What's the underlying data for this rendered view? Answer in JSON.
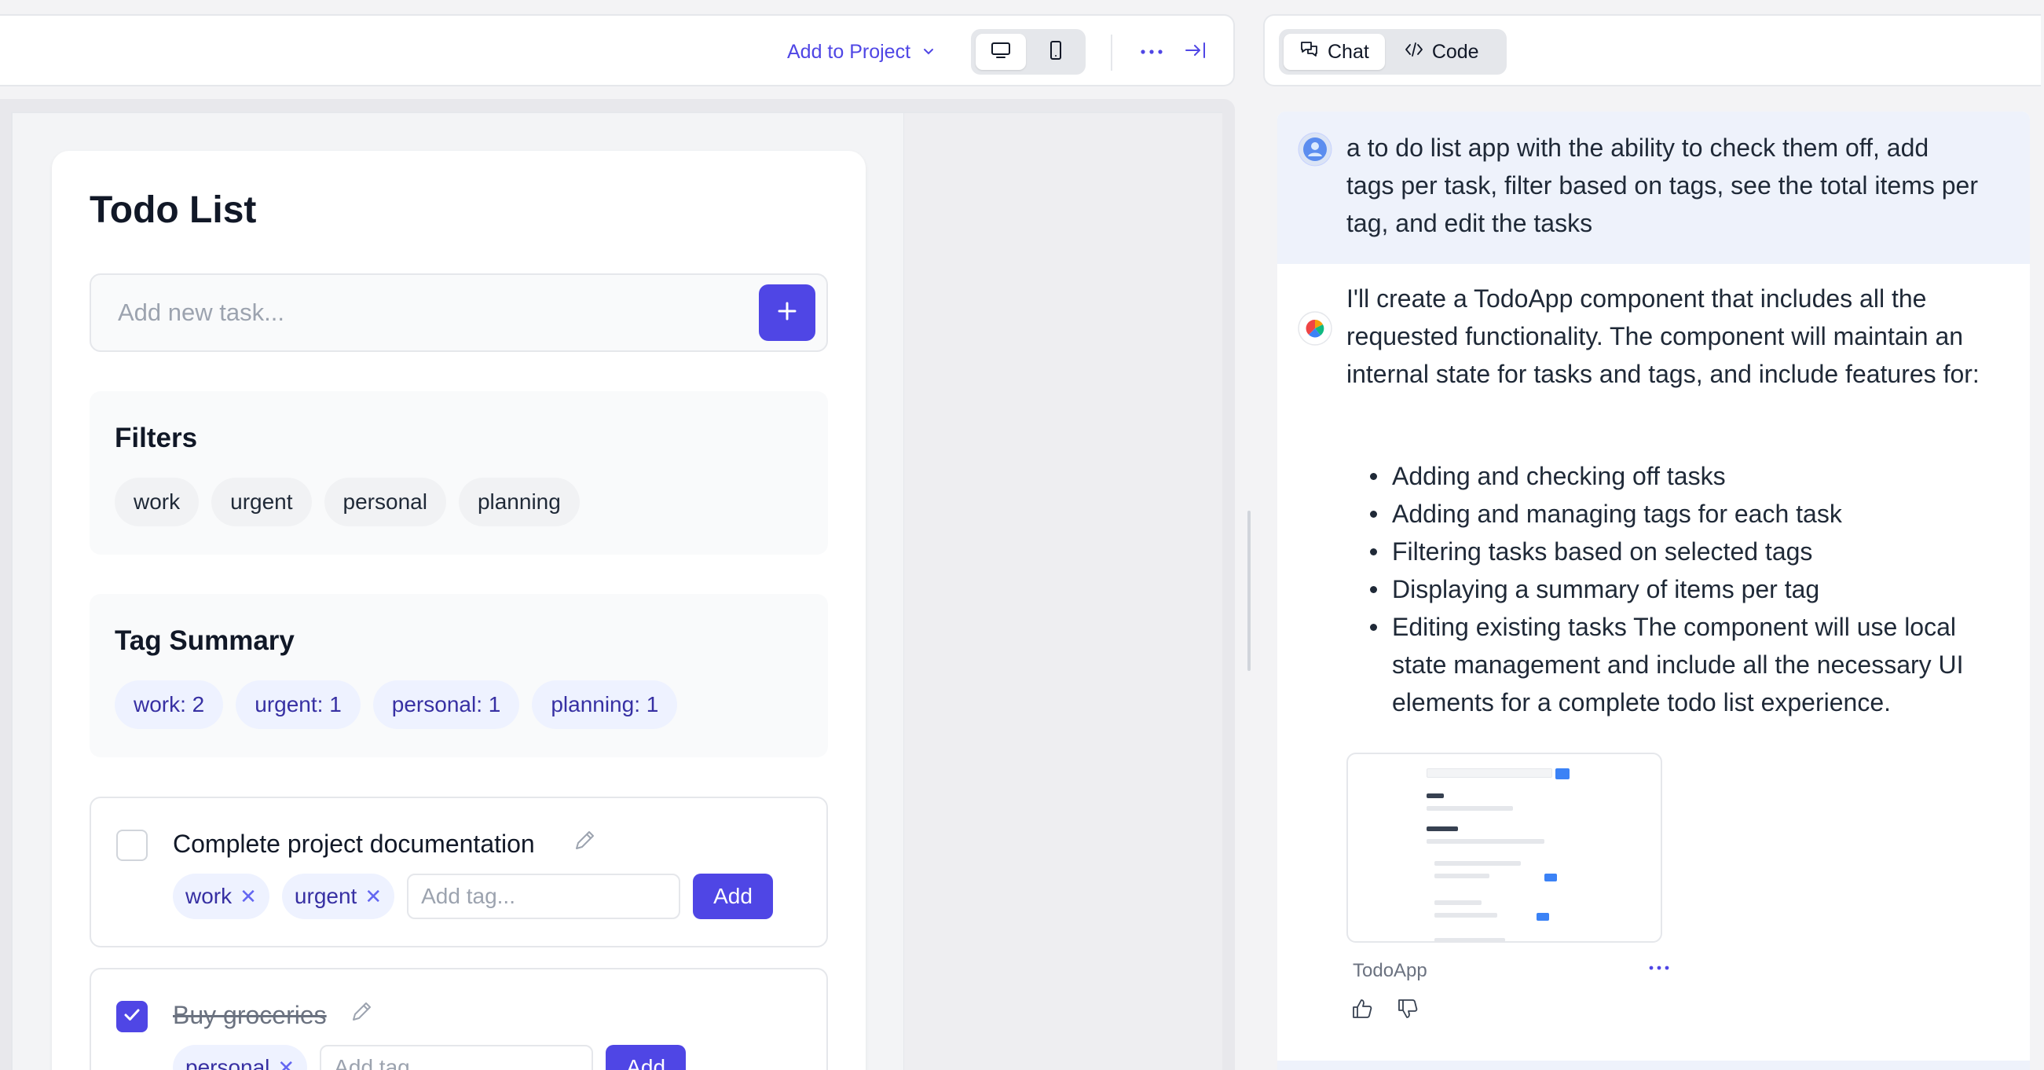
{
  "toolbar": {
    "add_to_project": "Add to Project",
    "icons": [
      "chevron-down-icon",
      "desktop-icon",
      "mobile-icon",
      "more-icon",
      "collapse-panel-icon"
    ]
  },
  "app": {
    "title": "Todo List",
    "add_placeholder": "Add new task...",
    "filters_title": "Filters",
    "filters": [
      "work",
      "urgent",
      "personal",
      "planning"
    ],
    "summary_title": "Tag Summary",
    "summary": [
      "work: 2",
      "urgent: 1",
      "personal: 1",
      "planning: 1"
    ],
    "tag_placeholder": "Add tag...",
    "add_label": "Add",
    "tasks": [
      {
        "text": "Complete project documentation",
        "done": false,
        "tags": [
          "work",
          "urgent"
        ]
      },
      {
        "text": "Buy groceries",
        "done": true,
        "tags": [
          "personal"
        ]
      }
    ]
  },
  "right": {
    "tabs": [
      "Chat",
      "Code"
    ],
    "user_message": [
      "a to do list app with the ability to check them off, add",
      "tags per task, filter based on tags, see the total items per",
      "tag, and edit the tasks"
    ],
    "assistant_intro": [
      "I'll create a TodoApp component that includes all the",
      "requested functionality. The component will maintain an",
      "internal state for tasks and tags, and include features for:"
    ],
    "bullets": [
      "Adding and checking off tasks",
      "Adding and managing tags for each task",
      "Filtering tasks based on selected tags",
      "Displaying a summary of items per tag",
      "Editing existing tasks The component will use local state management and include all the necessary UI elements for a complete todo list experience."
    ],
    "artifact_label": "TodoApp"
  },
  "colors": {
    "accent": "#4f46e5",
    "tag_bg": "#eef2ff",
    "tag_text": "#3730a3",
    "user_bg": "#eef2fb"
  }
}
